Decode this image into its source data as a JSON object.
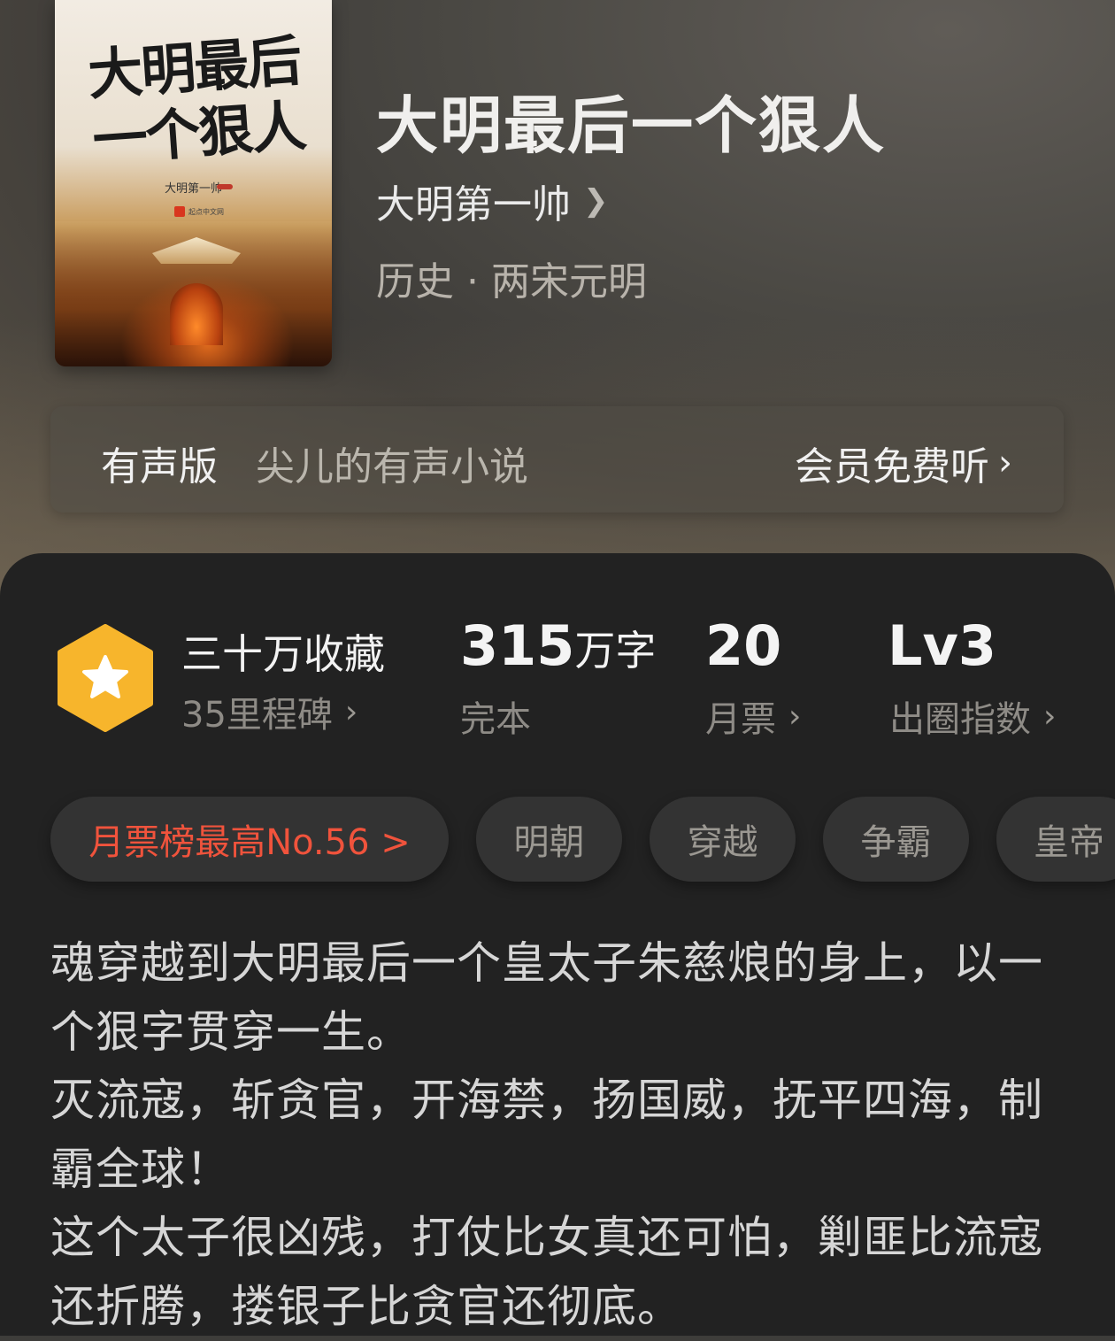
{
  "cover": {
    "title": "大明最后一个狠人",
    "author": "大明第一帅",
    "publisher": "起点中文网"
  },
  "book": {
    "title": "大明最后一个狠人",
    "author": "大明第一帅",
    "genre": "历史 · 两宋元明"
  },
  "audio": {
    "label": "有声版",
    "narrator": "尖儿的有声小说",
    "cta": "会员免费听"
  },
  "stats": {
    "collect_title": "三十万收藏",
    "collect_sub": "35里程碑",
    "words_value": "315",
    "words_unit": "万字",
    "words_sub": "完本",
    "tickets_value": "20",
    "tickets_sub": "月票",
    "index_value": "Lv3",
    "index_sub": "出圈指数"
  },
  "tags": {
    "rank": "月票榜最高No.56 >",
    "items": [
      "明朝",
      "穿越",
      "争霸",
      "皇帝"
    ]
  },
  "description": {
    "lines": [
      "魂穿越到大明最后一个皇太子朱慈烺的身上，以一个狠字贯穿一生。",
      "灭流寇，斩贪官，开海禁，扬国威，抚平四海，制霸全球！",
      "这个太子很凶残，打仗比女真还可怕，剿匪比流寇还折腾，搂银子比贪官还彻底。"
    ]
  },
  "colors": {
    "panel": "#222222",
    "chip": "#333333",
    "accent_red": "#f0533c",
    "badge_gold": "#f7b52c"
  },
  "icons": {
    "badge": "star-hexagon-icon",
    "chevron": "chevron-right-icon"
  }
}
